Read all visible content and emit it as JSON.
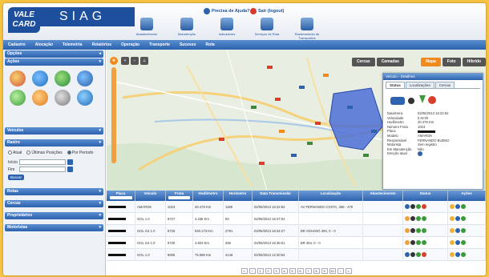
{
  "header": {
    "logo_text": "VALE CARD",
    "app_name": "SIAG",
    "help_text": "Precisa de Ajuda?",
    "logout_text": "Sair (logout)",
    "toolbar": [
      {
        "label": "Abastecimento",
        "icon": "fuel-icon"
      },
      {
        "label": "Manutenção",
        "icon": "wrench-icon"
      },
      {
        "label": "Indicadores",
        "icon": "chart-icon"
      },
      {
        "label": "Serviços de Rota",
        "icon": "route-icon"
      },
      {
        "label": "Rastreamento de Transportes",
        "icon": "truck-icon"
      }
    ]
  },
  "menu": [
    "Cadastro",
    "Alocação",
    "Telemetria",
    "Relatórios",
    "Operação",
    "Transporte",
    "Sucesso",
    "Rota"
  ],
  "sidebar": {
    "opcoes": "Opções",
    "acoes": "Ações",
    "veiculos": "Veículos",
    "rastro": "Rastro",
    "radio_options": [
      "Atual",
      "Últimas Posições",
      "Por Período"
    ],
    "selected_radio": "Por Período",
    "inicio_label": "Início",
    "fim_label": "Fim",
    "search_button": "Buscar",
    "sections": [
      "Rotas",
      "Cercas",
      "Proprietários",
      "Motoristas"
    ]
  },
  "map": {
    "tabs": [
      "Cercas",
      "Camadas",
      "Mapa",
      "Foto",
      "Híbrido"
    ],
    "selected_tab": "Mapa"
  },
  "vehicle_panel": {
    "title": "Veículo - Detalhes",
    "tabs": [
      "Status",
      "Localizações",
      "Cercas"
    ],
    "selected_tab": "Status",
    "fields": [
      {
        "k": "Data/Hora",
        "v": "02/05/2013 16:22:52"
      },
      {
        "k": "Velocidade",
        "v": "0 Km/h"
      },
      {
        "k": "Hodômetro",
        "v": "20.478 Km"
      },
      {
        "k": "Número Frota",
        "v": "1023"
      },
      {
        "k": "Placa",
        "v": ""
      },
      {
        "k": "Modelo",
        "v": "AMAROK"
      },
      {
        "k": "Responsável",
        "v": "FERNANDO BUENO"
      },
      {
        "k": "Motorista",
        "v": "Sem registro"
      },
      {
        "k": "Em Manutenção",
        "v": "Não"
      },
      {
        "k": "Direção atual",
        "v": ""
      }
    ]
  },
  "grid": {
    "columns": [
      "Placa",
      "Veículo",
      "Frota",
      "Hodômetro",
      "Horímetro",
      "Data Transmissão",
      "Localização",
      "Abastecimento",
      "Status",
      "Ações"
    ],
    "rows": [
      {
        "veiculo": "AMAROK",
        "frota": "1023",
        "hodometro": "20.478 Km",
        "horimetro": "1189",
        "data": "02/05/2013 16:22:52",
        "local": "AV FERNANDO COSTA, 356 - 470"
      },
      {
        "veiculo": "GOL 1.0",
        "frota": "8727",
        "hodometro": "3.338 Km",
        "horimetro": "93",
        "data": "02/05/2013 16:27:02",
        "local": ""
      },
      {
        "veiculo": "GOL G4 1.0",
        "frota": "8725",
        "hodometro": "540.173 Km",
        "horimetro": "2791",
        "data": "02/05/2013 16:34:27",
        "local": "BR ANHANG 494, 0 - 0"
      },
      {
        "veiculo": "GOL G4 1.0",
        "frota": "8726",
        "hodometro": "4.823 Km",
        "horimetro": "255",
        "data": "02/05/2013 16:35:01",
        "local": "BR 464, 0 - 0"
      },
      {
        "veiculo": "GOL 1.0",
        "frota": "9005",
        "hodometro": "75.085 Km",
        "horimetro": "4146",
        "data": "02/05/2013 12:30:54",
        "local": ""
      }
    ],
    "pages": [
      "1",
      "2",
      "3",
      "4",
      "5",
      "6",
      "7",
      "8",
      "9",
      "10"
    ]
  },
  "colors": {
    "brand": "#1d4f9c",
    "accent": "#f08a1c",
    "frame": "#f6c343"
  }
}
